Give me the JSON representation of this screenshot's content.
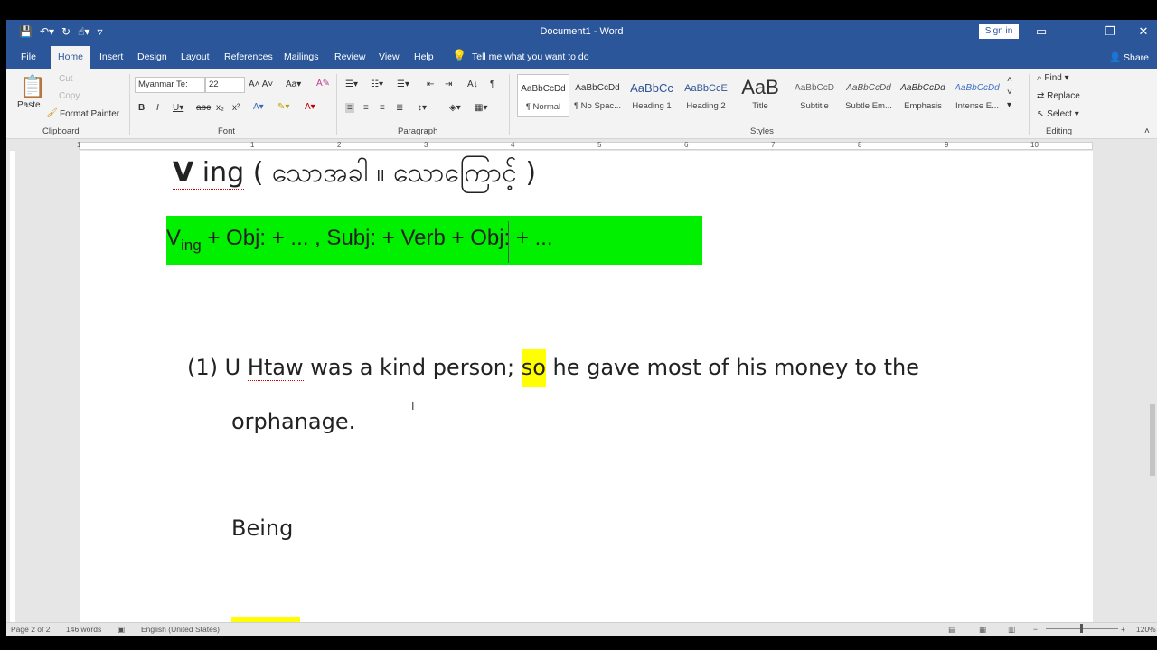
{
  "window": {
    "title": "Document1 - Word",
    "signin_label": "Sign in",
    "share_label": "Share"
  },
  "tabs": [
    "File",
    "Home",
    "Insert",
    "Design",
    "Layout",
    "References",
    "Mailings",
    "Review",
    "View",
    "Help"
  ],
  "active_tab": "Home",
  "tell_me": "Tell me what you want to do",
  "ribbon": {
    "clipboard": {
      "label": "Clipboard",
      "paste": "Paste",
      "cut": "Cut",
      "copy": "Copy",
      "format_painter": "Format Painter"
    },
    "font": {
      "label": "Font",
      "font_name": "Myanmar Te:",
      "font_size": "22"
    },
    "paragraph": {
      "label": "Paragraph"
    },
    "styles": {
      "label": "Styles",
      "items": [
        {
          "sample": "AaBbCcDd",
          "name": "¶ Normal"
        },
        {
          "sample": "AaBbCcDd",
          "name": "¶ No Spac..."
        },
        {
          "sample": "AaBbCc",
          "name": "Heading 1"
        },
        {
          "sample": "AaBbCcE",
          "name": "Heading 2"
        },
        {
          "sample": "AaB",
          "name": "Title"
        },
        {
          "sample": "AaBbCcD",
          "name": "Subtitle"
        },
        {
          "sample": "AaBbCcDd",
          "name": "Subtle Em..."
        },
        {
          "sample": "AaBbCcDd",
          "name": "Emphasis"
        },
        {
          "sample": "AaBbCcDd",
          "name": "Intense E..."
        }
      ]
    },
    "editing": {
      "label": "Editing",
      "find": "Find",
      "replace": "Replace",
      "select": "Select"
    }
  },
  "ruler_numbers": [
    "1",
    "1",
    "2",
    "3",
    "4",
    "5",
    "6",
    "7",
    "8",
    "9",
    "10"
  ],
  "document": {
    "heading_v": "V",
    "heading_ing": " ing",
    "heading_rest": " ( သောအခါ ။ သောကြောင့် )",
    "formula_v": "V",
    "formula_sub": "ing",
    "formula_left": "  +  Obj:  +  ...  ,  Subj:  +  ",
    "formula_right": "Verb + Obj:  + ...",
    "sentence1_prefix": "(1)   U ",
    "sentence1_htaw": "Htaw",
    "sentence1_mid": " was a kind person; ",
    "sentence1_so": "so",
    "sentence1_end": " he gave most of his money to the",
    "sentence2": "orphanage.",
    "being": "Being"
  },
  "status": {
    "page": "Page 2 of 2",
    "words": "146 words",
    "language": "English (United States)",
    "zoom": "120%"
  },
  "colors": {
    "title_bar": "#2b579a",
    "formula_bg": "#00f000",
    "highlight": "#ffff00"
  }
}
